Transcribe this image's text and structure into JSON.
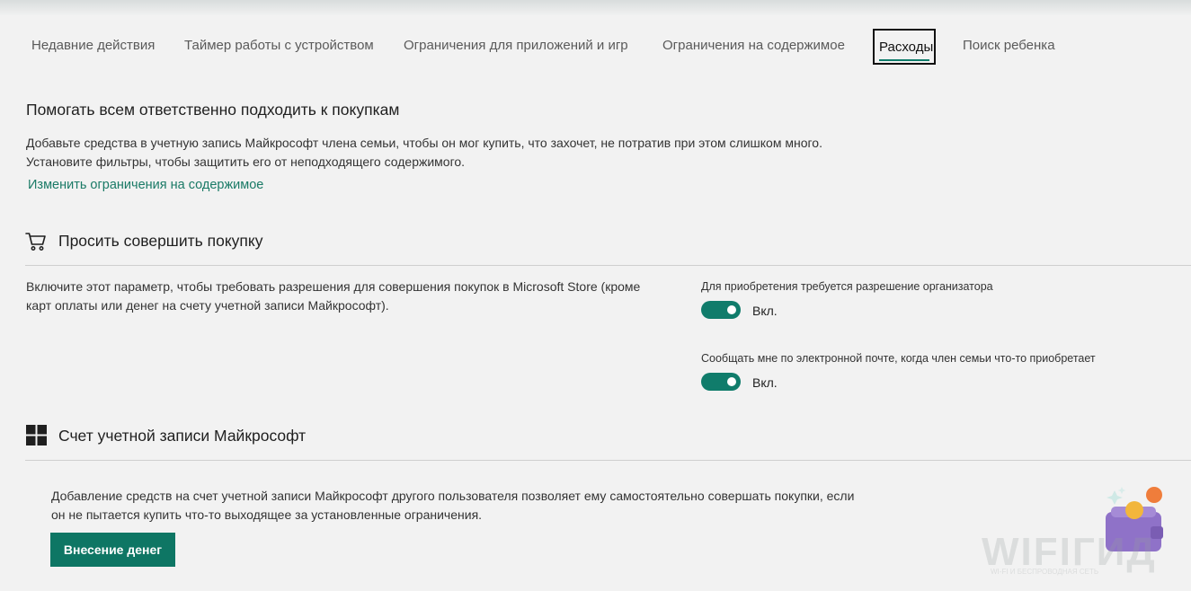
{
  "tabs": [
    {
      "label": "Недавние действия"
    },
    {
      "label": "Таймер работы с устройством"
    },
    {
      "label": "Ограничения для приложений и игр"
    },
    {
      "label": "Ограничения на содержимое"
    },
    {
      "label": "Расходы"
    },
    {
      "label": "Поиск ребенка"
    }
  ],
  "intro": {
    "heading": "Помогать всем ответственно подходить к покупкам",
    "line1": "Добавьте средства в учетную запись Майкрософт члена семьи, чтобы он мог купить, что захочет, не потратив при этом слишком много.",
    "line2": "Установите фильтры, чтобы защитить его от неподходящего содержимого.",
    "link": "Изменить ограничения на содержимое"
  },
  "ask_purchase": {
    "icon": "shopping-cart-icon",
    "title": "Просить совершить покупку",
    "desc_line1": "Включите этот параметр, чтобы требовать разрешения для совершения покупок в Microsoft Store (кроме",
    "desc_line2": "карт оплаты или денег на счету учетной записи Майкрософт).",
    "toggle1": {
      "label": "Для приобретения требуется разрешение организатора",
      "state": "Вкл.",
      "on": true
    },
    "toggle2": {
      "label": "Сообщать мне по электронной почте, когда член семьи что-то приобретает",
      "state": "Вкл.",
      "on": true
    }
  },
  "account": {
    "icon": "microsoft-logo-icon",
    "title": "Счет учетной записи Майкрософт",
    "desc_line1": "Добавление средств на счет учетной записи Майкрософт другого пользователя позволяет ему самостоятельно совершать покупки, если",
    "desc_line2": "он не пытается купить что-то выходящее за установленные ограничения.",
    "button": "Внесение денег"
  },
  "watermark": {
    "text": "WIFIГИД",
    "sub": "WI-FI И БЕСПРОВОДНАЯ СЕТЬ"
  },
  "colors": {
    "accent": "#0e7664",
    "link": "#1a7a66",
    "background": "#f2f2f2"
  }
}
